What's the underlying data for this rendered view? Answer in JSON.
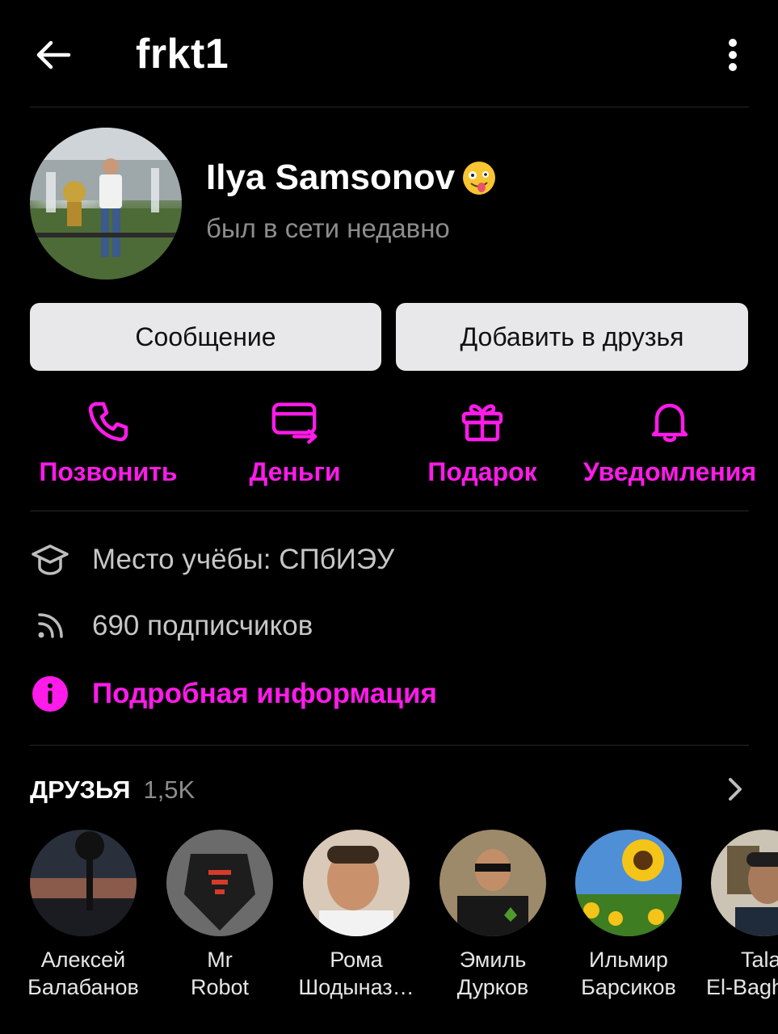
{
  "header": {
    "back_icon": "arrow-left-icon",
    "title": "frkt1",
    "more_icon": "more-vertical-icon"
  },
  "profile": {
    "name": "Ilya Samsonov",
    "name_emoji_icon": "zany-face-emoji",
    "status": "был в сети недавно"
  },
  "buttons": {
    "message": "Сообщение",
    "add_friend": "Добавить в друзья"
  },
  "actions": [
    {
      "label": "Позвонить",
      "icon": "phone-icon"
    },
    {
      "label": "Деньги",
      "icon": "money-transfer-icon"
    },
    {
      "label": "Подарок",
      "icon": "gift-icon"
    },
    {
      "label": "Уведомления",
      "icon": "bell-icon"
    }
  ],
  "info": {
    "education": "Место учёбы: СПбИЭУ",
    "followers": "690 подписчиков",
    "details_link": "Подробная информация"
  },
  "friends": {
    "title": "ДРУЗЬЯ",
    "count": "1,5K",
    "items": [
      {
        "first": "Алексей",
        "last": "Балабанов"
      },
      {
        "first": "Mr",
        "last": "Robot"
      },
      {
        "first": "Рома",
        "last": "Шодыназ…"
      },
      {
        "first": "Эмиль",
        "last": "Дурков"
      },
      {
        "first": "Ильмир",
        "last": "Барсиков"
      },
      {
        "first": "Tala",
        "last": "El-Bagh"
      }
    ]
  },
  "colors": {
    "accent": "#ff1be9",
    "background": "#000000",
    "button_bg": "#e8e8ea",
    "secondary_text": "#8c8c8c"
  }
}
